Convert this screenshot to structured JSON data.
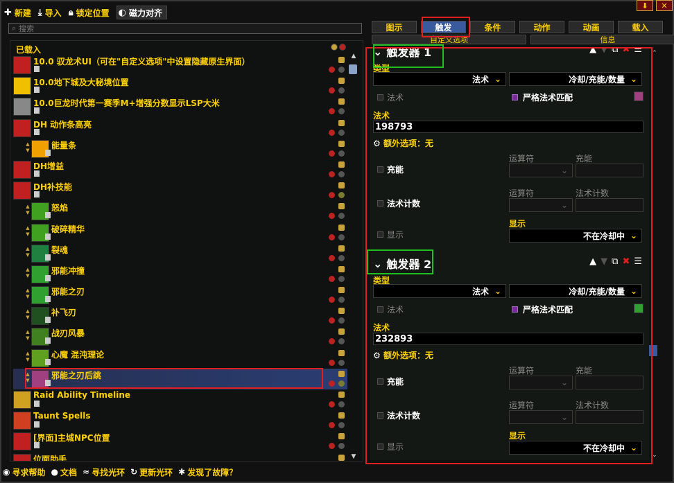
{
  "toolbar": {
    "new_label": "新建",
    "import_label": "导入",
    "lock_label": "锁定位置",
    "magnet_label": "磁力对齐"
  },
  "window_buttons": [
    "⬇",
    "✕"
  ],
  "search": {
    "placeholder": "搜索"
  },
  "left": {
    "loaded_label": "已载入",
    "auras": [
      {
        "name": "10.0 驭龙术UI（可在\"自定义选项\"中设置隐藏原生界面）",
        "color": "#c02020",
        "child": false
      },
      {
        "name": "10.0地下城及大秘境位置",
        "color": "#f0c000",
        "child": false
      },
      {
        "name": "10.0巨龙时代第一赛季M+增强分数显示LSP大米",
        "color": "#888888",
        "child": false
      },
      {
        "name": "DH 动作条高亮",
        "color": "#c02020",
        "child": false
      },
      {
        "name": "能量条",
        "color": "#f0a000",
        "child": true
      },
      {
        "name": "DH增益",
        "color": "#c02020",
        "child": false
      },
      {
        "name": "DH补技能",
        "color": "#c02020",
        "child": false
      },
      {
        "name": "怒焰",
        "color": "#40a020",
        "child": true
      },
      {
        "name": "破碎精华",
        "color": "#40a020",
        "child": true
      },
      {
        "name": "裂魂",
        "color": "#208040",
        "child": true
      },
      {
        "name": "邪能冲撞",
        "color": "#30a030",
        "child": true
      },
      {
        "name": "邪能之刃",
        "color": "#30a030",
        "child": true
      },
      {
        "name": "补飞刃",
        "color": "#205020",
        "child": true
      },
      {
        "name": "战刃风暴",
        "color": "#408020",
        "child": true
      },
      {
        "name": "心魔 混沌理论",
        "color": "#60a020",
        "child": true
      },
      {
        "name": "邪能之刃后跳",
        "color": "#a04080",
        "child": true,
        "selected": true
      },
      {
        "name": "Raid Ability Timeline",
        "color": "#d0a020",
        "child": false
      },
      {
        "name": "Taunt Spells",
        "color": "#d04020",
        "child": false
      },
      {
        "name": "[界面]主城NPC位置",
        "color": "#c02020",
        "child": false
      },
      {
        "name": "位面助手",
        "color": "#c02020",
        "child": false
      }
    ]
  },
  "tabs": [
    "图示",
    "触发",
    "条件",
    "动作",
    "动画",
    "载入"
  ],
  "active_tab": "触发",
  "subtabs": [
    "自定义选项",
    "信息"
  ],
  "triggers": [
    {
      "title": "触发器 1",
      "type_label": "类型",
      "type_value": "法术",
      "subtype_value": "冷却/充能/数量",
      "spell_cb_label": "法术",
      "strict_label": "严格法术匹配",
      "spell_label": "法术",
      "spell_id": "198793",
      "extra_label": "额外选项：无",
      "charges_label": "充能",
      "operator_label": "运算符",
      "charges_col": "充能",
      "spellcount_label": "法术计数",
      "operator_label2": "运算符",
      "spellcount_col": "法术计数",
      "show_cb_label": "显示",
      "show_label": "显示",
      "show_value": "不在冷却中"
    },
    {
      "title": "触发器 2",
      "type_label": "类型",
      "type_value": "法术",
      "subtype_value": "冷却/充能/数量",
      "spell_cb_label": "法术",
      "strict_label": "严格法术匹配",
      "spell_label": "法术",
      "spell_id": "232893",
      "extra_label": "额外选项：无",
      "charges_label": "充能",
      "operator_label": "运算符",
      "charges_col": "充能",
      "spellcount_label": "法术计数",
      "operator_label2": "运算符",
      "spellcount_col": "法术计数",
      "show_cb_label": "显示",
      "show_label": "显示",
      "show_value": "不在冷却中"
    }
  ],
  "bottom": {
    "help_label": "寻求帮助",
    "docs_label": "文档",
    "find_label": "寻找光环",
    "update_label": "更新光环",
    "bug_label": "发现了故障？"
  }
}
